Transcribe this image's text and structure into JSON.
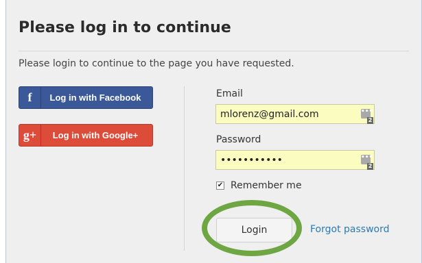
{
  "dialog": {
    "title": "Please log in to continue",
    "subtitle": "Please login to continue to the page you have requested."
  },
  "social": {
    "facebook": {
      "icon": "f",
      "label": "Log in with Facebook",
      "color": "#3b5998"
    },
    "google": {
      "icon": "g+",
      "label": "Log in with Google+",
      "color": "#dd4b39"
    }
  },
  "form": {
    "email_label": "Email",
    "email_value": "mlorenz@gmail.com",
    "password_label": "Password",
    "password_value": "•••••••••••",
    "password_manager_icon": "•••",
    "password_manager_count": "2",
    "remember_label": "Remember me",
    "remember_checked": "✔",
    "login_label": "Login",
    "forgot_label": "Forgot password"
  },
  "colors": {
    "autofill_bg": "#fafcc0",
    "highlight_ring": "#6da642",
    "link": "#2a7ab5"
  }
}
